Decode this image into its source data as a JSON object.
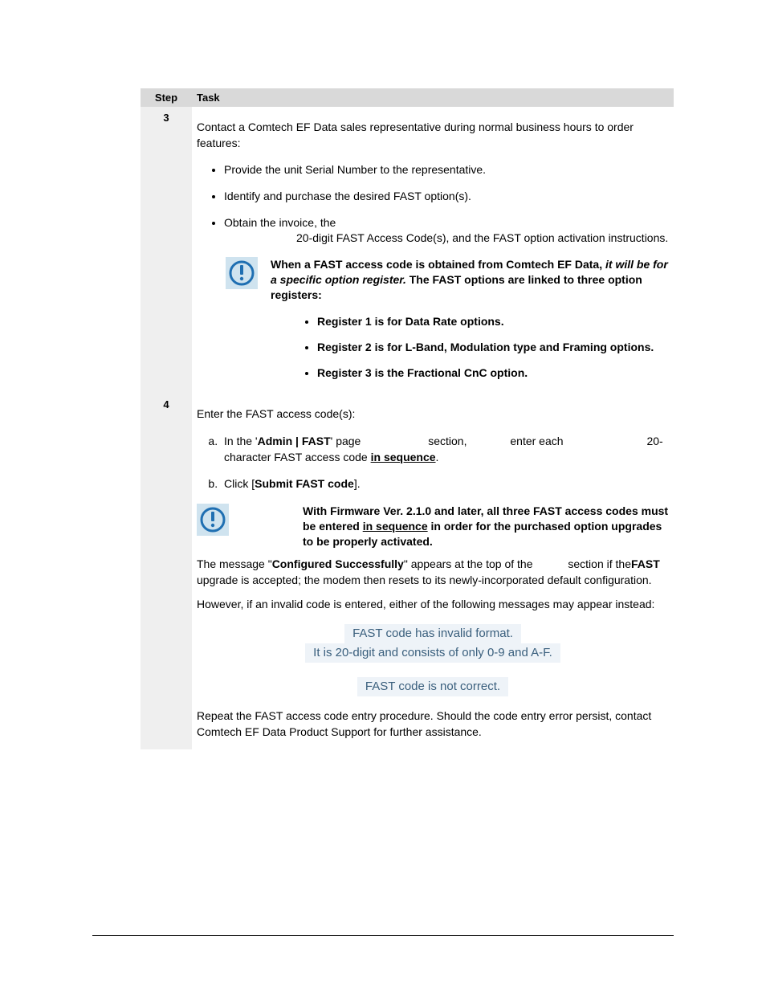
{
  "header": {
    "step": "Step",
    "task": "Task"
  },
  "step3": {
    "num": "3",
    "intro": "Contact a Comtech EF Data sales representative during normal business hours to order features:",
    "li1": "Provide the unit Serial Number to the representative.",
    "li2": "Identify and purchase the desired FAST option(s).",
    "li3a": "Obtain the invoice, the ",
    "li3b": "20-digit FAST Access Code(s), and the FAST option activation instructions.",
    "note1a": "When a FAST access code is obtained from Comtech EF Data, ",
    "note1b": "it will be for a specific option register.",
    "note1c": " The FAST options are linked to three option registers:",
    "reg1": "Register 1 is for Data Rate options.",
    "reg2": "Register 2 is for L-Band, Modulation type and Framing options.",
    "reg3": "Register 3 is the Fractional CnC option."
  },
  "step4": {
    "num": "4",
    "intro": "Enter the FAST access code(s):",
    "a1": "In the '",
    "a2": "Admin | FAST",
    "a3": "' page ",
    "a4": "section,",
    "a5": "enter each",
    "a6": "20-",
    "a7": "character FAST access code ",
    "a8": "in sequence",
    "a9": ".",
    "b1": "Click [",
    "b2": "Submit FAST code",
    "b3": "].",
    "note2a": "With Firmware Ver. 2.1.0 and later, all three FAST access codes must be entered ",
    "note2b": "in sequence",
    "note2c": " in order for the purchased option upgrades to be properly activated.",
    "msgIntro1": "The message \"",
    "msgIntro2": "Configured Successfully",
    "msgIntro3": "\" appears at the top of the ",
    "msgIntro4": "section if the ",
    "msgIntro5": "FAST",
    "msgIntro6": " upgrade is accepted; the modem then resets to its newly-incorporated default configuration.",
    "however": "However, if an invalid code is entered, either of the following messages may appear instead:",
    "err1a": "FAST code has invalid format.",
    "err1b": "It is 20-digit and consists of only 0-9 and A-F.",
    "err2": "FAST code is not correct.",
    "repeat": "Repeat the FAST access code entry procedure. Should the code entry error persist, contact Comtech EF Data Product Support for further assistance."
  }
}
